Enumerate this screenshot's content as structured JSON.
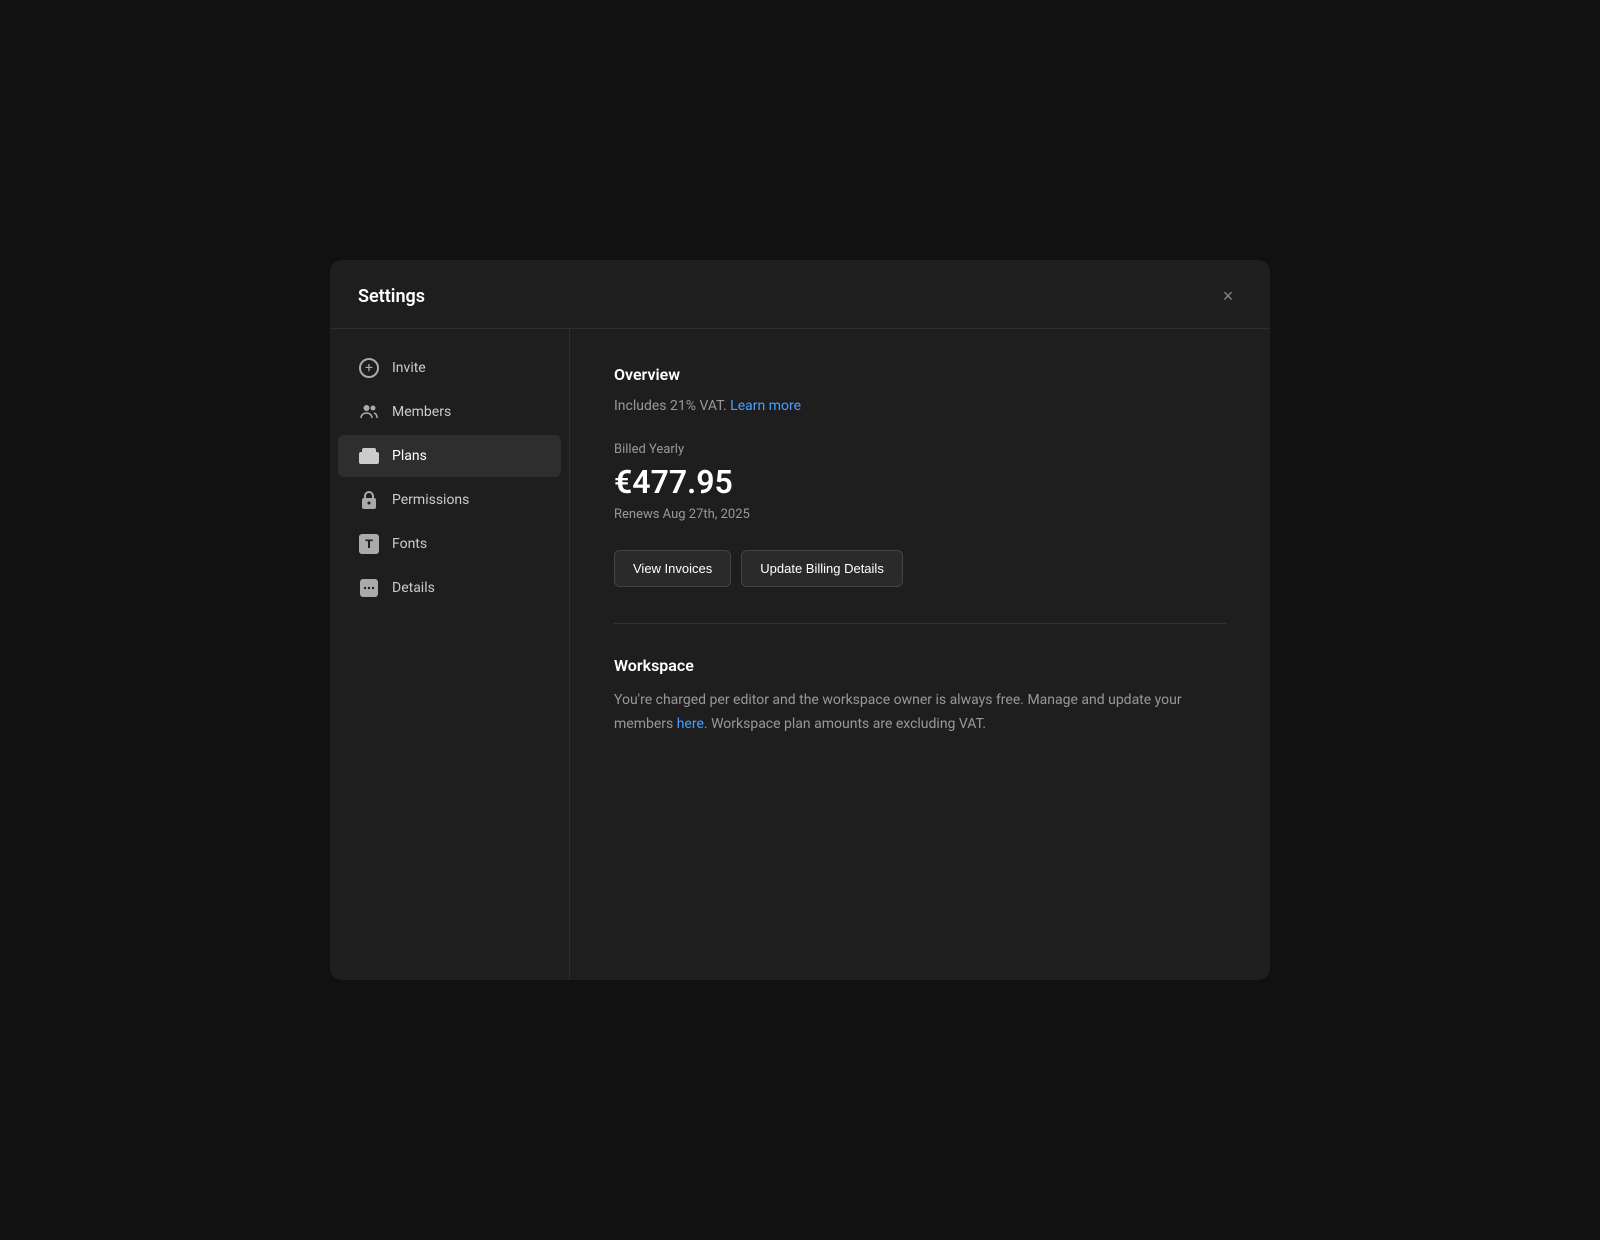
{
  "modal": {
    "title": "Settings",
    "close_label": "×"
  },
  "sidebar": {
    "items": [
      {
        "id": "invite",
        "label": "Invite",
        "icon": "invite-icon",
        "active": false
      },
      {
        "id": "members",
        "label": "Members",
        "icon": "members-icon",
        "active": false
      },
      {
        "id": "plans",
        "label": "Plans",
        "icon": "plans-icon",
        "active": true
      },
      {
        "id": "permissions",
        "label": "Permissions",
        "icon": "permissions-icon",
        "active": false
      },
      {
        "id": "fonts",
        "label": "Fonts",
        "icon": "fonts-icon",
        "active": false
      },
      {
        "id": "details",
        "label": "Details",
        "icon": "details-icon",
        "active": false
      }
    ]
  },
  "content": {
    "overview": {
      "title": "Overview",
      "vat_text": "Includes 21% VAT.",
      "learn_more_label": "Learn more",
      "billing_cycle": "Billed Yearly",
      "amount": "€477.95",
      "renews": "Renews Aug 27th, 2025",
      "view_invoices_label": "View Invoices",
      "update_billing_label": "Update Billing Details"
    },
    "workspace": {
      "title": "Workspace",
      "description_part1": "You're charged per editor and the workspace owner is always free. Manage and update your members ",
      "here_label": "here",
      "description_part2": ". Workspace plan amounts are excluding VAT."
    }
  }
}
